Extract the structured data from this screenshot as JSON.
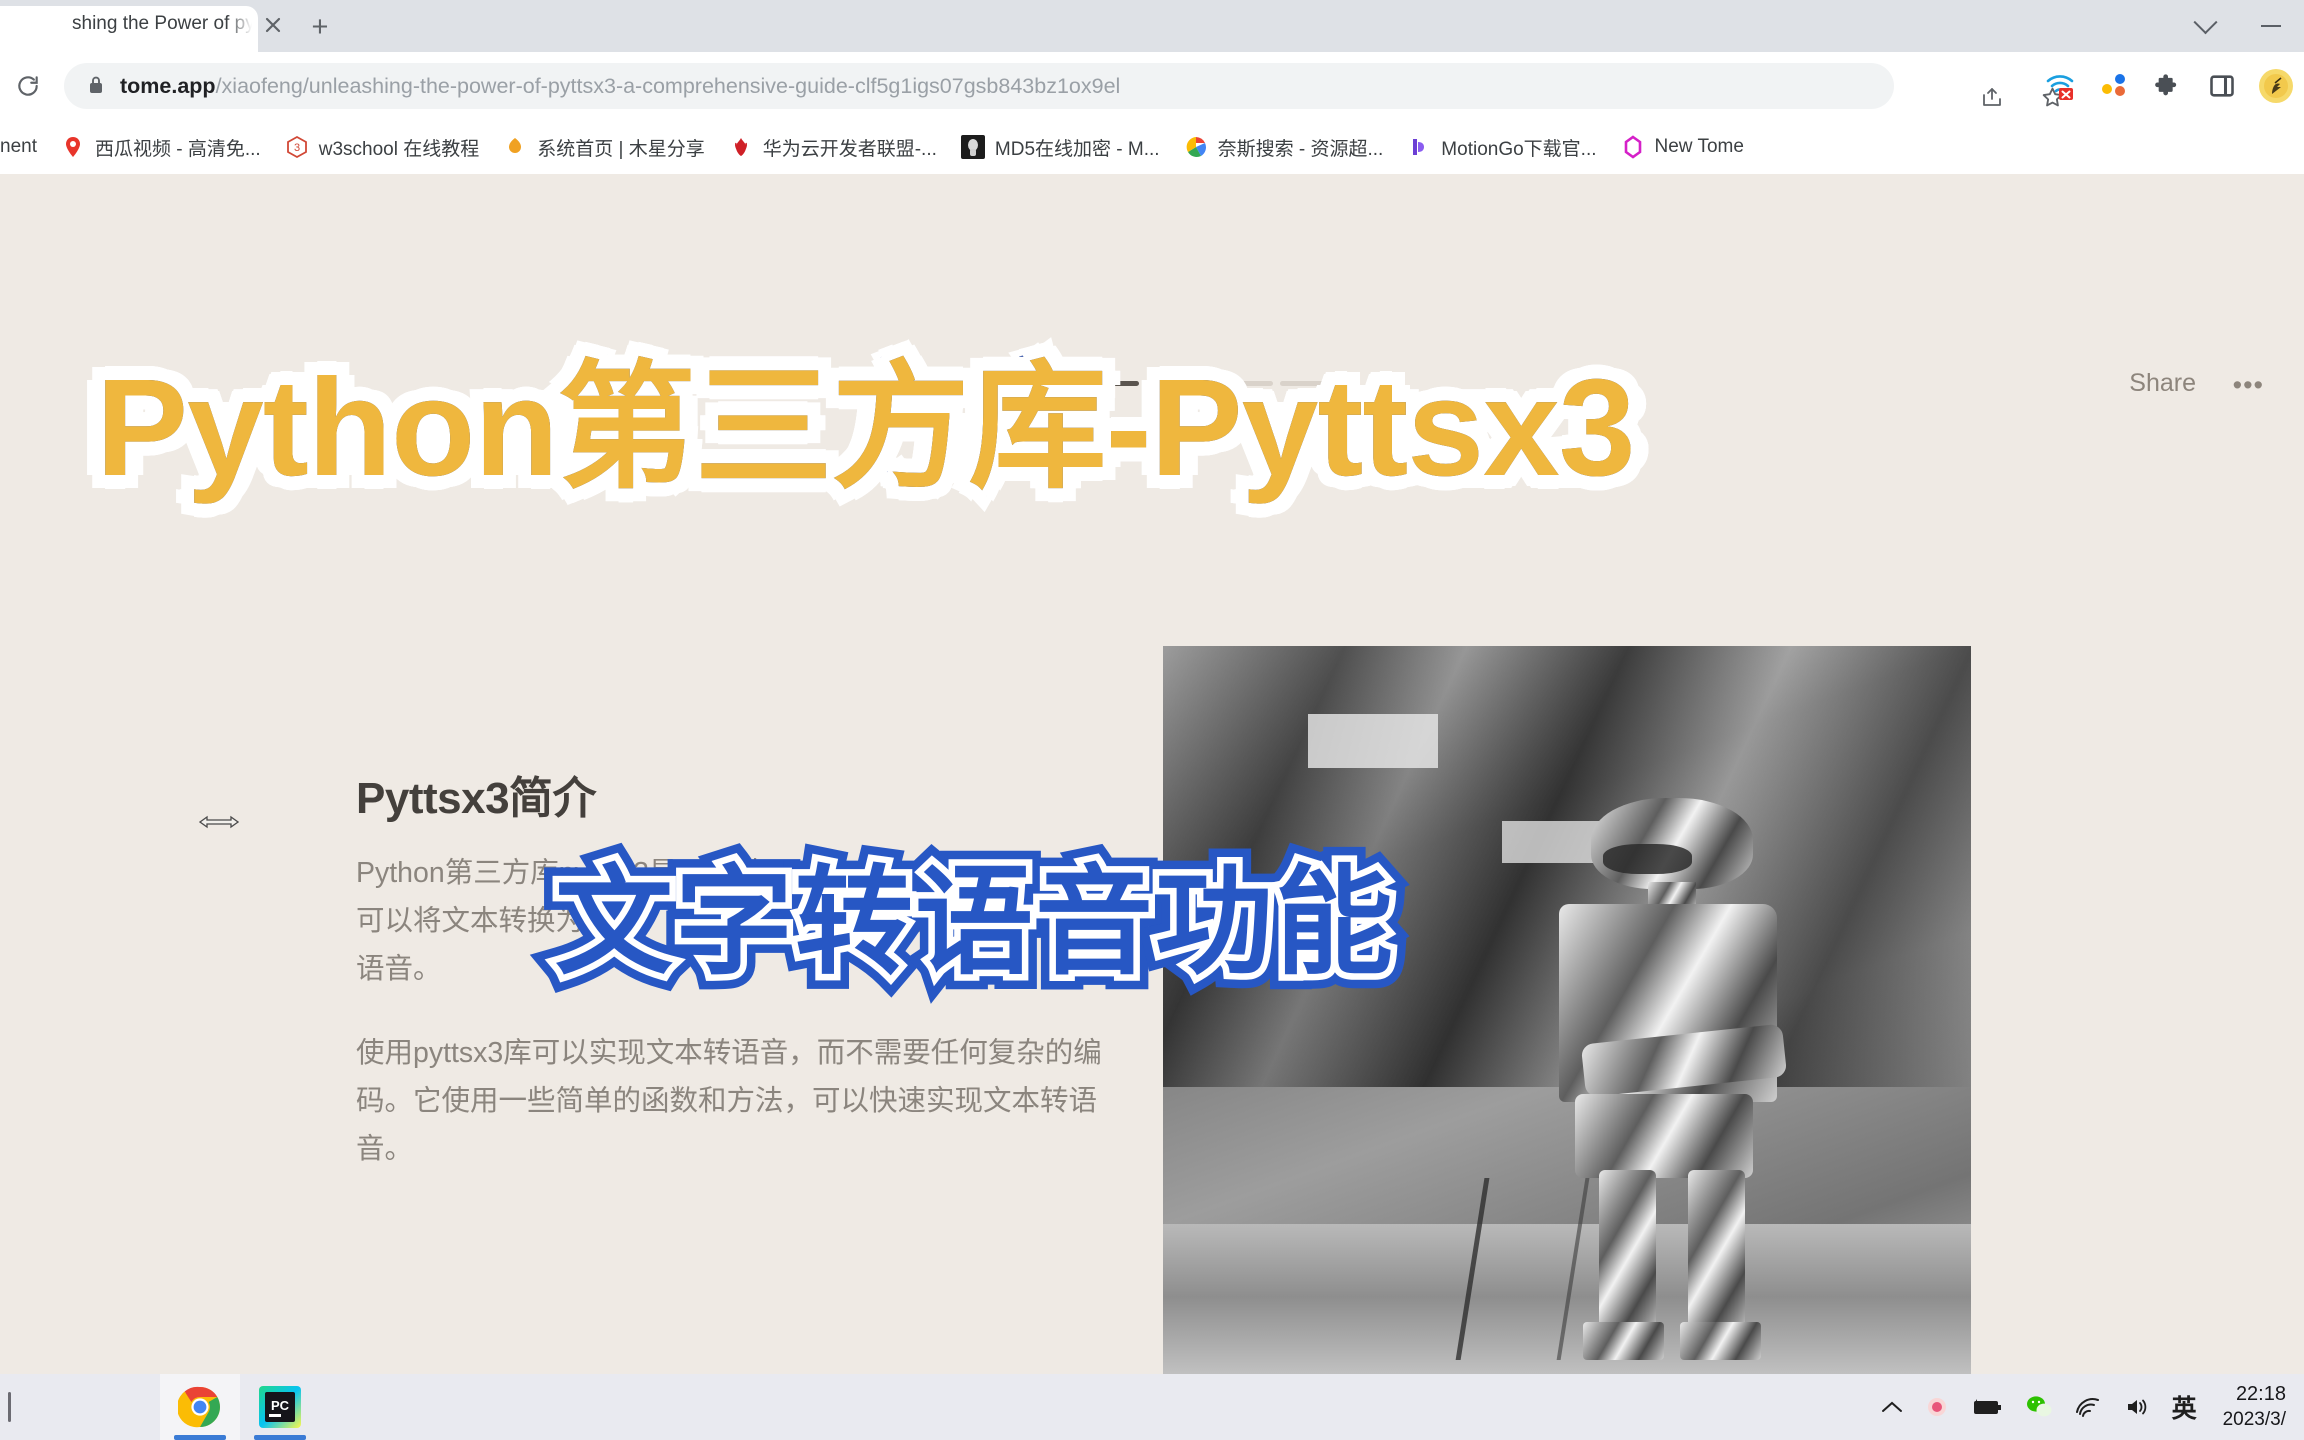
{
  "browser": {
    "tab": {
      "title": "shing the Power of pytts",
      "close_icon": "close-icon"
    },
    "new_tab_label": "+",
    "window_controls": {
      "chevron": "chevron-down-icon",
      "minimize": "minimize-icon"
    },
    "reload_icon": "reload-icon",
    "omnibox": {
      "lock_icon": "lock-icon",
      "url_domain": "tome.app",
      "url_path": "/xiaofeng/unleashing-the-power-of-pyttsx3-a-comprehensive-guide-clf5g1igs07gsb843bz1ox9el",
      "share_icon": "share-page-icon",
      "star_icon": "bookmark-star-icon"
    },
    "extensions": [
      {
        "name": "wifi-blocked-icon"
      },
      {
        "name": "dots-extension-icon"
      },
      {
        "name": "puzzle-extensions-icon"
      },
      {
        "name": "side-panel-icon"
      },
      {
        "name": "profile-avatar-icon"
      }
    ],
    "bookmarks": [
      {
        "label": "nent",
        "icon": "generic-bookmark-icon"
      },
      {
        "label": "西瓜视频 - 高清免...",
        "icon": "xigua-icon"
      },
      {
        "label": "w3school 在线教程",
        "icon": "w3school-icon"
      },
      {
        "label": "系统首页 | 木星分享",
        "icon": "muxing-icon"
      },
      {
        "label": "华为云开发者联盟-...",
        "icon": "huawei-cloud-icon"
      },
      {
        "label": "MD5在线加密 - M...",
        "icon": "md5-icon"
      },
      {
        "label": "奈斯搜索 - 资源超...",
        "icon": "naisi-search-icon"
      },
      {
        "label": "MotionGo下载官...",
        "icon": "motiongo-icon"
      },
      {
        "label": "New Tome",
        "icon": "tome-icon"
      }
    ]
  },
  "page": {
    "progress": {
      "total": 6,
      "active": 3
    },
    "share_label": "Share",
    "more_menu": "•••",
    "slide": {
      "heading": "Pyttsx3简介",
      "paragraph_1": "Python第三方库pyttsx3是一个基于Python的文本转语音库，它可以将文本转换为英语，法语，西班牙语，德语，意大利语等语音。",
      "paragraph_2": "使用pyttsx3库可以实现文本转语音，而不需要任何复杂的编码。它使用一些简单的函数和方法，可以快速实现文本转语音。",
      "image_alt": "silver-robot-photo"
    },
    "overlay": {
      "title_main": "Python第三方库-Pyttsx3",
      "title_sub": "文字转语音功能",
      "title_main_fill": "#efb73e",
      "title_main_stroke": "#1e3f9c",
      "title_sub_color": "#2757c4"
    },
    "cursor": "horizontal-resize-cursor"
  },
  "taskbar": {
    "apps": [
      {
        "name": "chrome-taskbar-icon",
        "active": true
      },
      {
        "name": "pycharm-taskbar-icon",
        "active": false
      }
    ],
    "tray": [
      {
        "name": "show-hidden-icons-chevron"
      },
      {
        "name": "recording-dot-icon"
      },
      {
        "name": "battery-charging-icon"
      },
      {
        "name": "wechat-icon"
      },
      {
        "name": "network-wifi-icon"
      },
      {
        "name": "volume-icon"
      },
      {
        "name": "ime-language-icon",
        "label": "英"
      }
    ],
    "clock_time": "22:18",
    "clock_date": "2023/3/"
  }
}
